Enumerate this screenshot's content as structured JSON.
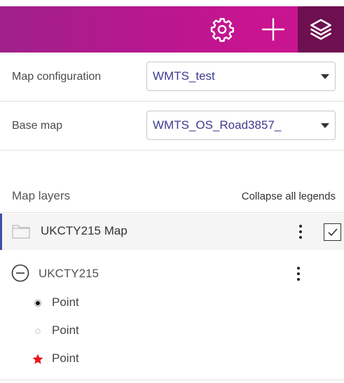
{
  "toolbar": {
    "settings_icon": "gear-icon",
    "add_icon": "plus-icon",
    "layers_icon": "layers-icon",
    "gradient_colors": [
      "#a0208a",
      "#c8148f"
    ],
    "active_button_color": "#6e0f4f"
  },
  "map_configuration": {
    "label": "Map configuration",
    "selected": "WMTS_test"
  },
  "base_map": {
    "label": "Base map",
    "selected": "WMTS_OS_Road3857_"
  },
  "layers": {
    "title": "Map layers",
    "collapse_link": "Collapse all legends",
    "group": {
      "label": "UKCTY215 Map",
      "checked": true,
      "icon": "folder-icon"
    },
    "layer": {
      "label": "UKCTY215",
      "icon": "collapse-minus-icon",
      "legend": [
        {
          "label": "Point",
          "symbol": "filled-black-dot"
        },
        {
          "label": "Point",
          "symbol": "hollow-grey-dot"
        },
        {
          "label": "Point",
          "symbol": "red-star"
        }
      ]
    }
  }
}
